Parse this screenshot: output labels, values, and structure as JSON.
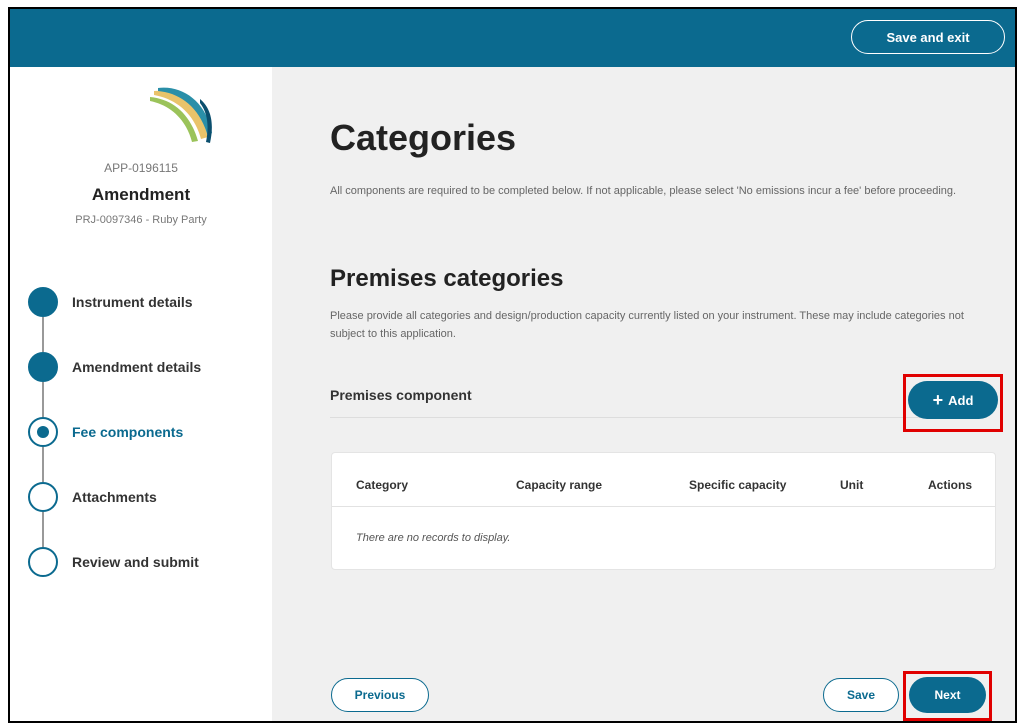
{
  "header": {
    "save_exit_label": "Save and exit"
  },
  "sidebar": {
    "app_id": "APP-0196115",
    "title": "Amendment",
    "project": "PRJ-0097346 - Ruby Party",
    "steps": [
      {
        "label": "Instrument details",
        "status": "done"
      },
      {
        "label": "Amendment details",
        "status": "done"
      },
      {
        "label": "Fee components",
        "status": "current"
      },
      {
        "label": "Attachments",
        "status": "pending"
      },
      {
        "label": "Review and submit",
        "status": "pending"
      }
    ]
  },
  "main": {
    "title": "Categories",
    "intro": "All components are required to be completed below. If not applicable, please select 'No emissions incur a fee' before proceeding.",
    "section": {
      "title": "Premises categories",
      "description": "Please provide all categories and design/production capacity currently listed on your instrument. These may include categories not subject to this application.",
      "component_label": "Premises component",
      "add_label": "Add"
    },
    "table": {
      "columns": [
        "Category",
        "Capacity range",
        "Specific capacity",
        "Unit",
        "Actions"
      ],
      "empty_text": "There are no records to display."
    },
    "footer": {
      "previous_label": "Previous",
      "save_label": "Save",
      "next_label": "Next"
    }
  },
  "colors": {
    "primary": "#0b6a8f",
    "highlight": "#e00000",
    "background": "#f0f0f0"
  },
  "icons": {
    "add": "plus-icon",
    "logo": "agency-logo"
  }
}
